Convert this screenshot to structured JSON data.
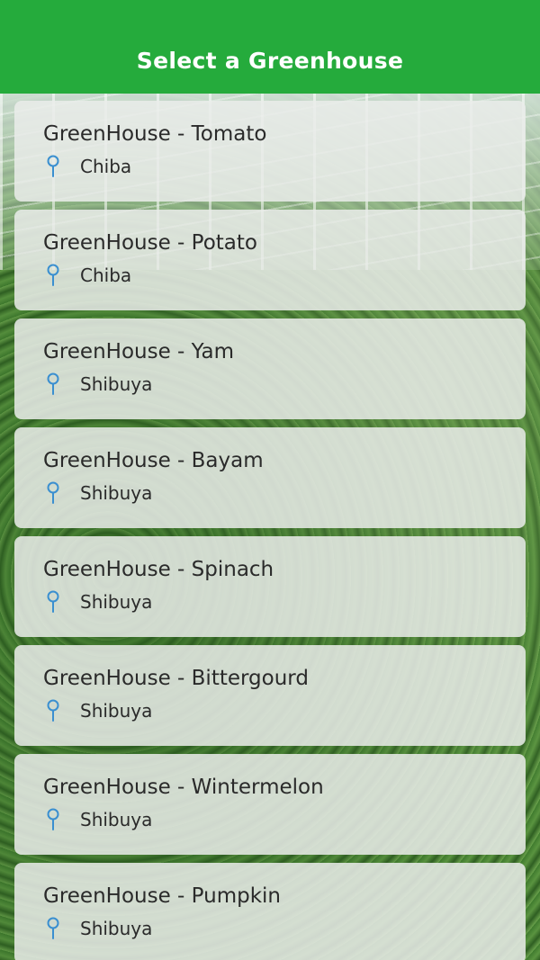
{
  "header": {
    "title": "Select a Greenhouse",
    "color": "#25ab3c"
  },
  "pin_icon": "location-pin-icon",
  "greenhouses": [
    {
      "name": "GreenHouse - Tomato",
      "location": "Chiba"
    },
    {
      "name": "GreenHouse - Potato",
      "location": "Chiba"
    },
    {
      "name": "GreenHouse - Yam",
      "location": "Shibuya"
    },
    {
      "name": "GreenHouse - Bayam",
      "location": "Shibuya"
    },
    {
      "name": "GreenHouse - Spinach",
      "location": "Shibuya"
    },
    {
      "name": "GreenHouse - Bittergourd",
      "location": "Shibuya"
    },
    {
      "name": "GreenHouse - Wintermelon",
      "location": "Shibuya"
    },
    {
      "name": "GreenHouse - Pumpkin",
      "location": "Shibuya"
    }
  ],
  "colors": {
    "pin": "#3a8fd0",
    "card_bg": "rgba(234,236,234,0.86)"
  }
}
